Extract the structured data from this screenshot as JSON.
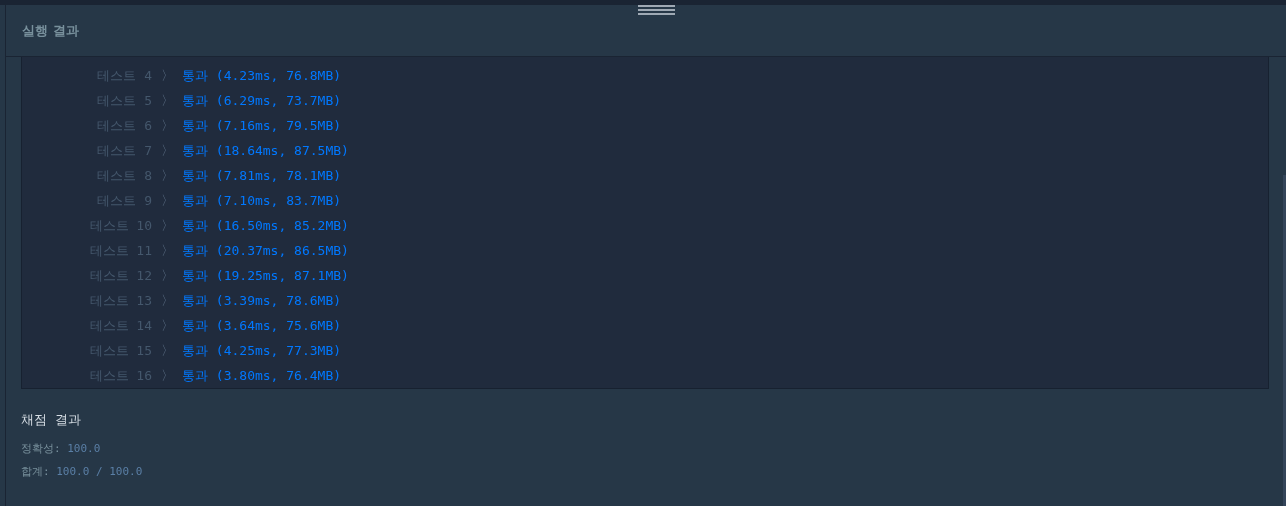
{
  "panel": {
    "title": "실행 결과"
  },
  "results": [
    {
      "label": "테스트 4",
      "separator": "〉",
      "result": "통과 (4.23ms, 76.8MB)"
    },
    {
      "label": "테스트 5",
      "separator": "〉",
      "result": "통과 (6.29ms, 73.7MB)"
    },
    {
      "label": "테스트 6",
      "separator": "〉",
      "result": "통과 (7.16ms, 79.5MB)"
    },
    {
      "label": "테스트 7",
      "separator": "〉",
      "result": "통과 (18.64ms, 87.5MB)"
    },
    {
      "label": "테스트 8",
      "separator": "〉",
      "result": "통과 (7.81ms, 78.1MB)"
    },
    {
      "label": "테스트 9",
      "separator": "〉",
      "result": "통과 (7.10ms, 83.7MB)"
    },
    {
      "label": "테스트 10",
      "separator": "〉",
      "result": "통과 (16.50ms, 85.2MB)"
    },
    {
      "label": "테스트 11",
      "separator": "〉",
      "result": "통과 (20.37ms, 86.5MB)"
    },
    {
      "label": "테스트 12",
      "separator": "〉",
      "result": "통과 (19.25ms, 87.1MB)"
    },
    {
      "label": "테스트 13",
      "separator": "〉",
      "result": "통과 (3.39ms, 78.6MB)"
    },
    {
      "label": "테스트 14",
      "separator": "〉",
      "result": "통과 (3.64ms, 75.6MB)"
    },
    {
      "label": "테스트 15",
      "separator": "〉",
      "result": "통과 (4.25ms, 77.3MB)"
    },
    {
      "label": "테스트 16",
      "separator": "〉",
      "result": "통과 (3.80ms, 76.4MB)"
    }
  ],
  "grading": {
    "title": "채점 결과",
    "lines": [
      {
        "label": "정확성:",
        "value": "100.0"
      },
      {
        "label": "합계:",
        "value": "100.0 / 100.0"
      }
    ]
  }
}
